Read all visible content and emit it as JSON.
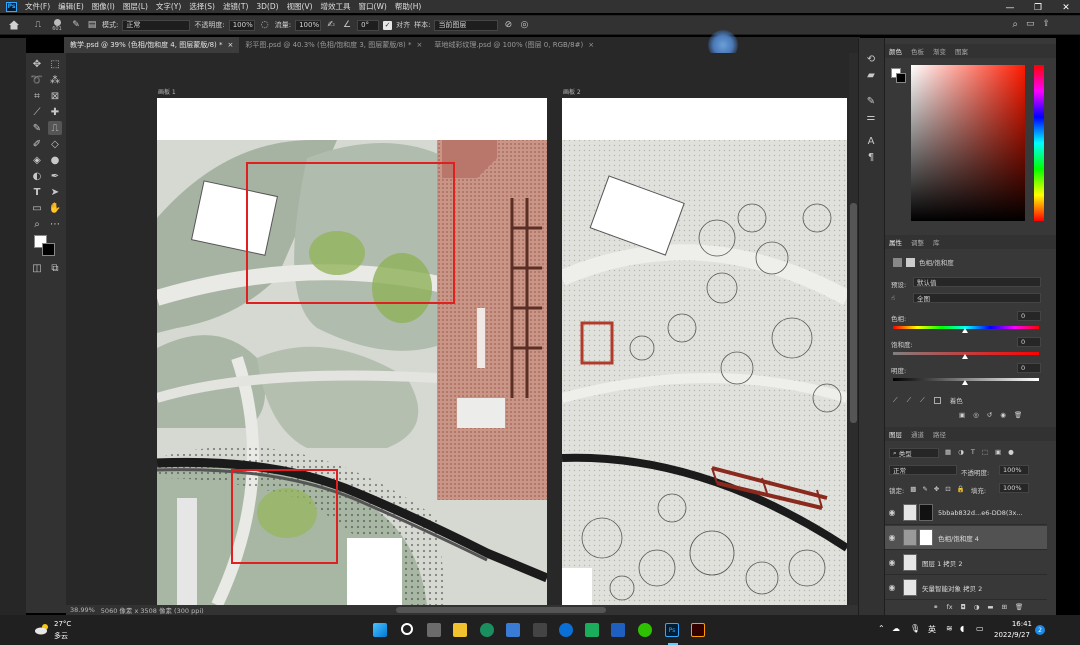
{
  "menubar": {
    "app_icon": "Ps",
    "items": [
      "文件(F)",
      "编辑(E)",
      "图像(I)",
      "图层(L)",
      "文字(Y)",
      "选择(S)",
      "滤镜(T)",
      "3D(D)",
      "视图(V)",
      "增效工具",
      "窗口(W)",
      "帮助(H)"
    ],
    "win_minimize": "—",
    "win_restore": "❐",
    "win_close": "✕"
  },
  "options": {
    "brush_size": "601",
    "mode_label": "模式:",
    "mode_value": "正常",
    "opacity_label": "不透明度:",
    "opacity_value": "100%",
    "flow_label": "流量:",
    "flow_value": "100%",
    "angle_value": "0°",
    "aligned_label": "对齐",
    "sample_label": "样本:",
    "sample_value": "当前图层"
  },
  "tabs": [
    {
      "label": "教学.psd @ 39% (色相/饱和度 4, 图层蒙版/8) *",
      "close": "×"
    },
    {
      "label": "彩平图.psd @ 40.3% (色相/饱和度 3, 图层蒙版/8) *",
      "close": "×"
    },
    {
      "label": "草地绒彩纹理.psd @ 100% (图层 0, RGB/8#)",
      "close": "×"
    }
  ],
  "artboards": {
    "a1": "画板 1",
    "a2": "画板 2"
  },
  "status": {
    "zoom": "38.99%",
    "doc_info": "5060 像素 x 3508 像素 (300 ppi)"
  },
  "color_panel": {
    "tabs": [
      "颜色",
      "色板",
      "渐变",
      "图案"
    ]
  },
  "properties": {
    "tabs": [
      "属性",
      "调整",
      "库"
    ],
    "title": "色相/饱和度",
    "preset_label": "预设:",
    "preset_value": "默认值",
    "channel_value": "全图",
    "hue_label": "色相:",
    "hue_value": "0",
    "sat_label": "饱和度:",
    "sat_value": "0",
    "light_label": "明度:",
    "light_value": "0",
    "colorize_label": "着色"
  },
  "layers_panel": {
    "tabs": [
      "图层",
      "通道",
      "路径"
    ],
    "filter_value": "类型",
    "blend_value": "正常",
    "opacity_label": "不透明度:",
    "opacity_value": "100%",
    "lock_label": "锁定:",
    "fill_label": "填充:",
    "fill_value": "100%",
    "layers": [
      {
        "name": "5bbab832d...e6-DD8(3x..."
      },
      {
        "name": "色相/饱和度 4"
      },
      {
        "name": "图层 1 拷贝 2"
      },
      {
        "name": "矢量智能对象 拷贝 2"
      }
    ]
  },
  "taskbar": {
    "weather_temp": "27°C",
    "weather_text": "多云",
    "ime": "英",
    "time": "16:41",
    "date": "2022/9/27",
    "badge": "2"
  },
  "colors": {
    "accent": "#31a8ff",
    "marker": "#e02020"
  }
}
